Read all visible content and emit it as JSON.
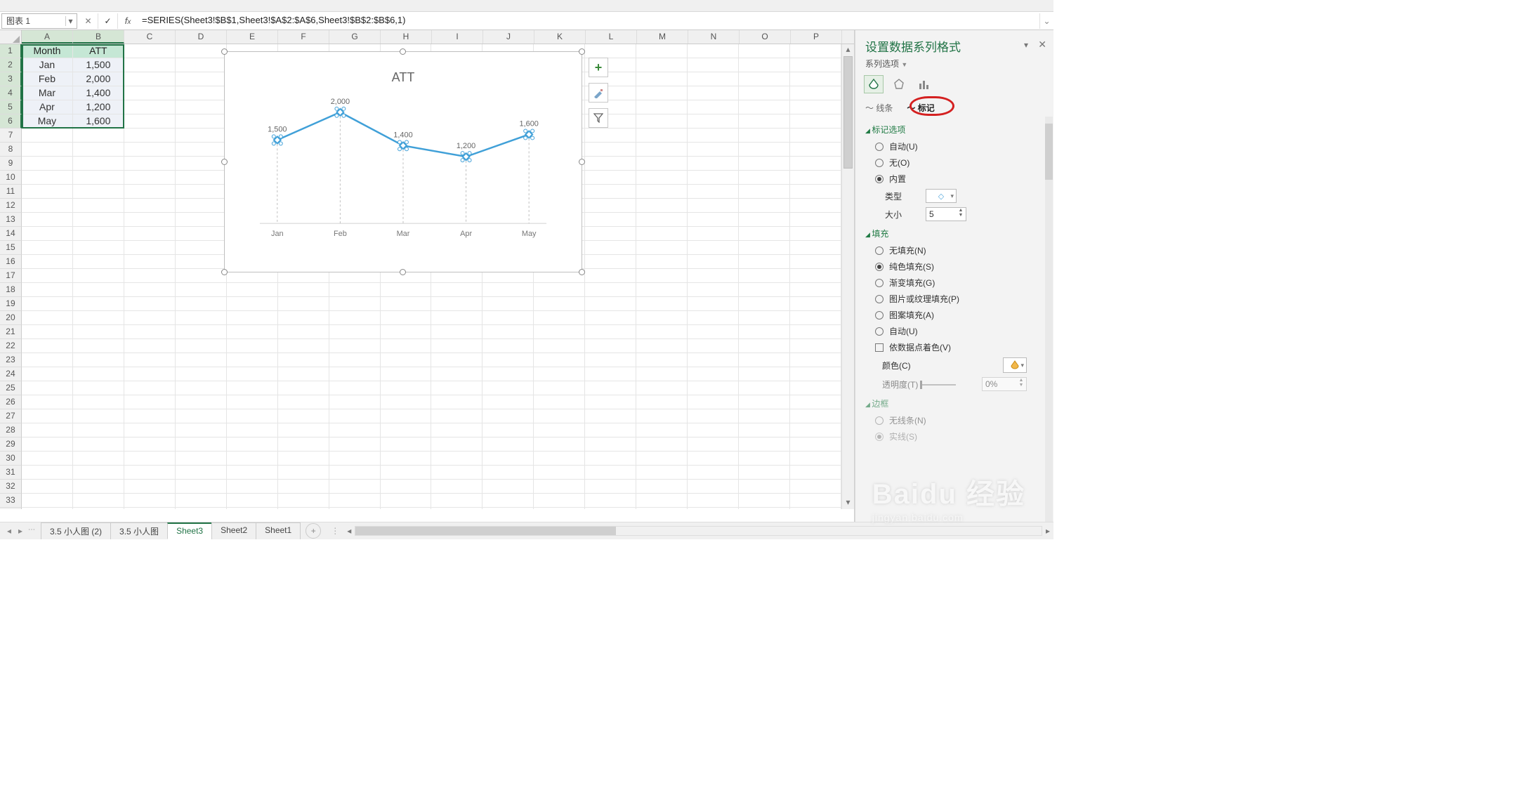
{
  "name_box": "图表 1",
  "formula": "=SERIES(Sheet3!$B$1,Sheet3!$A$2:$A$6,Sheet3!$B$2:$B$6,1)",
  "columns": [
    "A",
    "B",
    "C",
    "D",
    "E",
    "F",
    "G",
    "H",
    "I",
    "J",
    "K",
    "L",
    "M",
    "N",
    "O",
    "P"
  ],
  "row_count": 34,
  "data_headers": {
    "a": "Month",
    "b": "ATT"
  },
  "data_rows": [
    {
      "a": "Jan",
      "b": "1,500"
    },
    {
      "a": "Feb",
      "b": "2,000"
    },
    {
      "a": "Mar",
      "b": "1,400"
    },
    {
      "a": "Apr",
      "b": "1,200"
    },
    {
      "a": "May",
      "b": "1,600"
    }
  ],
  "chart_data": {
    "type": "line",
    "title": "ATT",
    "categories": [
      "Jan",
      "Feb",
      "Mar",
      "Apr",
      "May"
    ],
    "series": [
      {
        "name": "ATT",
        "values": [
          1500,
          2000,
          1400,
          1200,
          1600
        ],
        "labels": [
          "1,500",
          "2,000",
          "1,400",
          "1,200",
          "1,600"
        ]
      }
    ],
    "ylim": [
      0,
      2200
    ]
  },
  "sheet_tabs": [
    "3.5 小人图 (2)",
    "3.5 小人图",
    "Sheet3",
    "Sheet2",
    "Sheet1"
  ],
  "active_tab": "Sheet3",
  "pane": {
    "title": "设置数据系列格式",
    "subtitle": "系列选项",
    "tab_line": "线条",
    "tab_marker": "标记",
    "sec_marker_options": "标记选项",
    "opt_auto": "自动(U)",
    "opt_none": "无(O)",
    "opt_builtin": "内置",
    "lbl_type": "类型",
    "lbl_size": "大小",
    "size_value": "5",
    "sec_fill": "填充",
    "fill_none": "无填充(N)",
    "fill_solid": "纯色填充(S)",
    "fill_gradient": "渐变填充(G)",
    "fill_picture": "图片或纹理填充(P)",
    "fill_pattern": "图案填充(A)",
    "fill_auto": "自动(U)",
    "vary_colors": "依数据点着色(V)",
    "lbl_color": "颜色(C)",
    "lbl_trans": "透明度(T)",
    "trans_value": "0%",
    "sec_border": "边框",
    "border_none": "无线条(N)",
    "border_solid": "实线(S)"
  },
  "watermark": {
    "big": "Baidu 经验",
    "small": "jingyan.baidu.com"
  }
}
